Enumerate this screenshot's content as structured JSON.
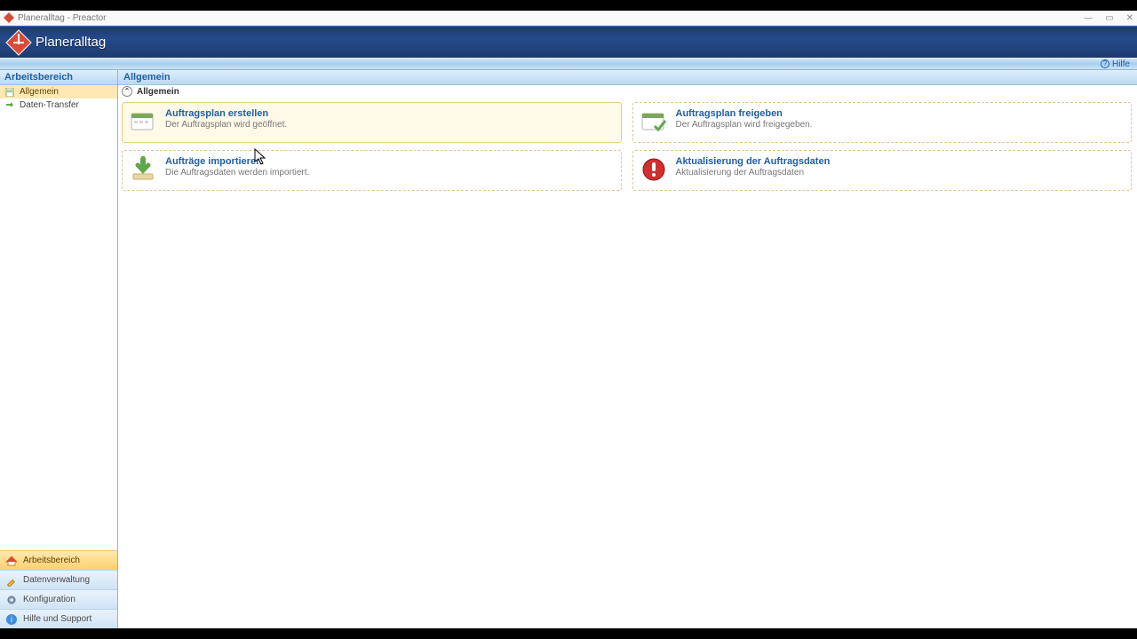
{
  "window": {
    "title": "Planeralltag - Preactor",
    "controls": {
      "minimize": "—",
      "maximize": "▭",
      "close": "✕"
    }
  },
  "ribbon": {
    "title": "Planeralltag"
  },
  "help": {
    "label": "Hilfe"
  },
  "sidebar": {
    "header": "Arbeitsbereich",
    "items": [
      {
        "label": "Allgemein",
        "active": true
      },
      {
        "label": "Daten-Transfer",
        "active": false
      }
    ],
    "tabs": [
      {
        "label": "Arbeitsbereich",
        "active": true
      },
      {
        "label": "Datenverwaltung",
        "active": false
      },
      {
        "label": "Konfiguration",
        "active": false
      },
      {
        "label": "Hilfe und Support",
        "active": false
      }
    ]
  },
  "content": {
    "header": "Allgemein",
    "section": {
      "title": "Allgemein"
    },
    "tiles": [
      {
        "title": "Auftragsplan erstellen",
        "desc": "Der Auftragsplan wird geöffnet.",
        "hovered": true
      },
      {
        "title": "Auftragsplan freigeben",
        "desc": "Der Auftragsplan wird freigegeben.",
        "hovered": false
      },
      {
        "title": "Aufträge importieren",
        "desc": "Die Auftragsdaten werden importiert.",
        "hovered": false
      },
      {
        "title": "Aktualisierung der Auftragsdaten",
        "desc": "Aktualisierung der Auftragsdaten",
        "hovered": false
      }
    ]
  }
}
